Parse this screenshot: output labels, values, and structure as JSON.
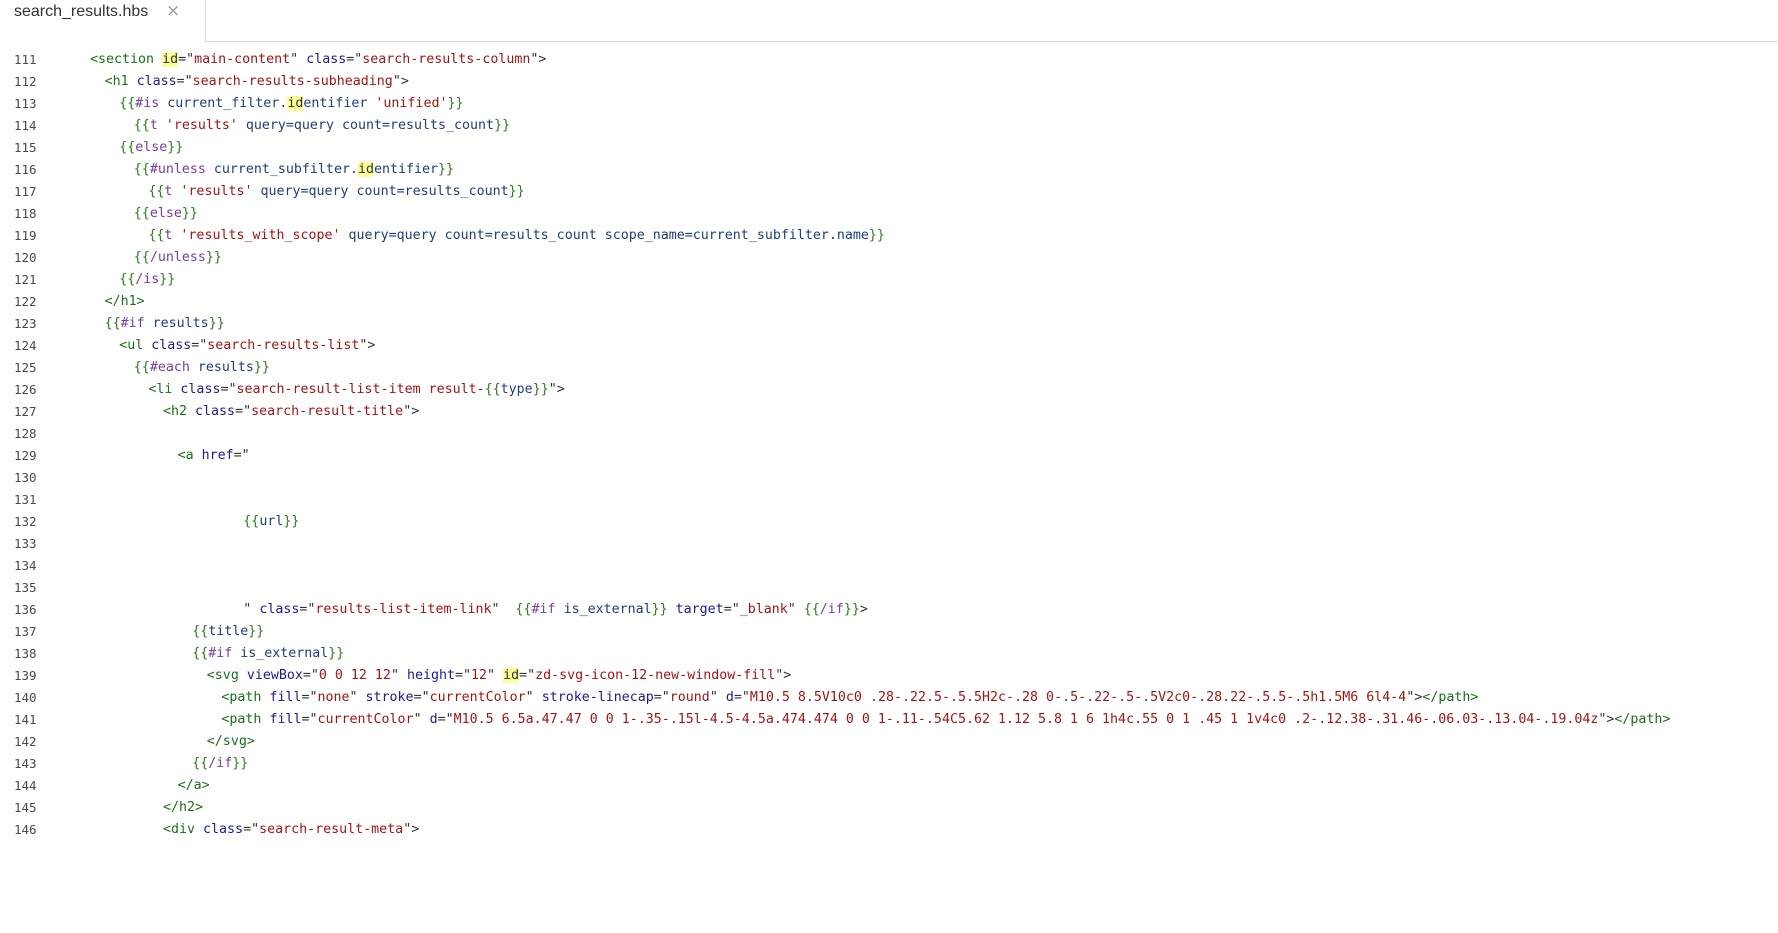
{
  "tab": {
    "filename": "search_results.hbs",
    "close_glyph": "×"
  },
  "colors": {
    "tag": "#1f6e1a",
    "attr": "#1b1b8f",
    "string": "#a31515",
    "keyword": "#7a3e9d",
    "variable": "#1f3f7a",
    "bracket": "#2e7d1f",
    "highlight": "#ffff99"
  },
  "lines": [
    {
      "n": "111",
      "indent": 0,
      "tokens": [
        [
          "tag",
          "<section "
        ],
        [
          "hl",
          "id"
        ],
        [
          "plain",
          "=\""
        ],
        [
          "str",
          "main-content"
        ],
        [
          "plain",
          "\" "
        ],
        [
          "attr",
          "class"
        ],
        [
          "plain",
          "=\""
        ],
        [
          "str",
          "search-results-column"
        ],
        [
          "plain",
          "\">"
        ]
      ]
    },
    {
      "n": "112",
      "indent": 2,
      "tokens": [
        [
          "tag",
          "<h1 "
        ],
        [
          "attr",
          "class"
        ],
        [
          "plain",
          "=\""
        ],
        [
          "str",
          "search-results-subheading"
        ],
        [
          "plain",
          "\">"
        ]
      ]
    },
    {
      "n": "113",
      "indent": 4,
      "tokens": [
        [
          "bracket",
          "{{"
        ],
        [
          "kw",
          "#is "
        ],
        [
          "var",
          "current_filter."
        ],
        [
          "hl",
          "id"
        ],
        [
          "var",
          "entifier "
        ],
        [
          "str",
          "'unified'"
        ],
        [
          "bracket",
          "}}"
        ]
      ]
    },
    {
      "n": "114",
      "indent": 6,
      "tokens": [
        [
          "bracket",
          "{{"
        ],
        [
          "kw",
          "t "
        ],
        [
          "str",
          "'results' "
        ],
        [
          "var",
          "query=query count=results_count"
        ],
        [
          "bracket",
          "}}"
        ]
      ]
    },
    {
      "n": "115",
      "indent": 4,
      "tokens": [
        [
          "bracket",
          "{{"
        ],
        [
          "kw",
          "else"
        ],
        [
          "bracket",
          "}}"
        ]
      ]
    },
    {
      "n": "116",
      "indent": 6,
      "tokens": [
        [
          "bracket",
          "{{"
        ],
        [
          "kw",
          "#unless "
        ],
        [
          "var",
          "current_subfilter."
        ],
        [
          "hl",
          "id"
        ],
        [
          "var",
          "entifier"
        ],
        [
          "bracket",
          "}}"
        ]
      ]
    },
    {
      "n": "117",
      "indent": 8,
      "tokens": [
        [
          "bracket",
          "{{"
        ],
        [
          "kw",
          "t "
        ],
        [
          "str",
          "'results' "
        ],
        [
          "var",
          "query=query count=results_count"
        ],
        [
          "bracket",
          "}}"
        ]
      ]
    },
    {
      "n": "118",
      "indent": 6,
      "tokens": [
        [
          "bracket",
          "{{"
        ],
        [
          "kw",
          "else"
        ],
        [
          "bracket",
          "}}"
        ]
      ]
    },
    {
      "n": "119",
      "indent": 8,
      "tokens": [
        [
          "bracket",
          "{{"
        ],
        [
          "kw",
          "t "
        ],
        [
          "str",
          "'results_with_scope' "
        ],
        [
          "var",
          "query=query count=results_count scope_name=current_subfilter.name"
        ],
        [
          "bracket",
          "}}"
        ]
      ]
    },
    {
      "n": "120",
      "indent": 6,
      "tokens": [
        [
          "bracket",
          "{{"
        ],
        [
          "kw",
          "/unless"
        ],
        [
          "bracket",
          "}}"
        ]
      ]
    },
    {
      "n": "121",
      "indent": 4,
      "tokens": [
        [
          "bracket",
          "{{"
        ],
        [
          "kw",
          "/is"
        ],
        [
          "bracket",
          "}}"
        ]
      ]
    },
    {
      "n": "122",
      "indent": 2,
      "tokens": [
        [
          "tag",
          "</h1>"
        ]
      ]
    },
    {
      "n": "123",
      "indent": 2,
      "tokens": [
        [
          "bracket",
          "{{"
        ],
        [
          "kw",
          "#if "
        ],
        [
          "var",
          "results"
        ],
        [
          "bracket",
          "}}"
        ]
      ]
    },
    {
      "n": "124",
      "indent": 4,
      "tokens": [
        [
          "tag",
          "<ul "
        ],
        [
          "attr",
          "class"
        ],
        [
          "plain",
          "=\""
        ],
        [
          "str",
          "search-results-list"
        ],
        [
          "plain",
          "\">"
        ]
      ]
    },
    {
      "n": "125",
      "indent": 6,
      "tokens": [
        [
          "bracket",
          "{{"
        ],
        [
          "kw",
          "#each "
        ],
        [
          "var",
          "results"
        ],
        [
          "bracket",
          "}}"
        ]
      ]
    },
    {
      "n": "126",
      "indent": 8,
      "tokens": [
        [
          "tag",
          "<li "
        ],
        [
          "attr",
          "class"
        ],
        [
          "plain",
          "=\""
        ],
        [
          "str",
          "search-result-list-item result-"
        ],
        [
          "bracket",
          "{{"
        ],
        [
          "var",
          "type"
        ],
        [
          "bracket",
          "}}"
        ],
        [
          "plain",
          "\">"
        ]
      ]
    },
    {
      "n": "127",
      "indent": 10,
      "tokens": [
        [
          "tag",
          "<h2 "
        ],
        [
          "attr",
          "class"
        ],
        [
          "plain",
          "=\""
        ],
        [
          "str",
          "search-result-title"
        ],
        [
          "plain",
          "\">"
        ]
      ]
    },
    {
      "n": "128",
      "indent": 0,
      "tokens": []
    },
    {
      "n": "129",
      "indent": 12,
      "tokens": [
        [
          "tag",
          "<a "
        ],
        [
          "attr",
          "href"
        ],
        [
          "plain",
          "=\""
        ]
      ]
    },
    {
      "n": "130",
      "indent": 0,
      "tokens": []
    },
    {
      "n": "131",
      "indent": 0,
      "tokens": []
    },
    {
      "n": "132",
      "indent": 21,
      "tokens": [
        [
          "bracket",
          "{{"
        ],
        [
          "var",
          "url"
        ],
        [
          "bracket",
          "}}"
        ]
      ]
    },
    {
      "n": "133",
      "indent": 0,
      "tokens": []
    },
    {
      "n": "134",
      "indent": 0,
      "tokens": []
    },
    {
      "n": "135",
      "indent": 0,
      "tokens": []
    },
    {
      "n": "136",
      "indent": 21,
      "tokens": [
        [
          "plain",
          "\" "
        ],
        [
          "attr",
          "class"
        ],
        [
          "plain",
          "=\""
        ],
        [
          "str",
          "results-list-item-link"
        ],
        [
          "plain",
          "\"  "
        ],
        [
          "bracket",
          "{{"
        ],
        [
          "kw",
          "#if "
        ],
        [
          "var",
          "is_external"
        ],
        [
          "bracket",
          "}}"
        ],
        [
          "plain",
          " "
        ],
        [
          "attr",
          "target"
        ],
        [
          "plain",
          "=\""
        ],
        [
          "str",
          "_blank"
        ],
        [
          "plain",
          "\" "
        ],
        [
          "bracket",
          "{{"
        ],
        [
          "kw",
          "/if"
        ],
        [
          "bracket",
          "}}"
        ],
        [
          "plain",
          ">"
        ]
      ]
    },
    {
      "n": "137",
      "indent": 14,
      "tokens": [
        [
          "bracket",
          "{{"
        ],
        [
          "var",
          "title"
        ],
        [
          "bracket",
          "}}"
        ]
      ]
    },
    {
      "n": "138",
      "indent": 14,
      "tokens": [
        [
          "bracket",
          "{{"
        ],
        [
          "kw",
          "#if "
        ],
        [
          "var",
          "is_external"
        ],
        [
          "bracket",
          "}}"
        ]
      ]
    },
    {
      "n": "139",
      "indent": 16,
      "tokens": [
        [
          "tag",
          "<svg "
        ],
        [
          "attr",
          "viewBox"
        ],
        [
          "plain",
          "=\""
        ],
        [
          "str",
          "0 0 12 12"
        ],
        [
          "plain",
          "\" "
        ],
        [
          "attr",
          "height"
        ],
        [
          "plain",
          "=\""
        ],
        [
          "str",
          "12"
        ],
        [
          "plain",
          "\" "
        ],
        [
          "hl",
          "id"
        ],
        [
          "plain",
          "=\""
        ],
        [
          "str",
          "zd-svg-icon-12-new-window-fill"
        ],
        [
          "plain",
          "\">"
        ]
      ]
    },
    {
      "n": "140",
      "indent": 18,
      "tokens": [
        [
          "tag",
          "<path "
        ],
        [
          "attr",
          "fill"
        ],
        [
          "plain",
          "=\""
        ],
        [
          "str",
          "none"
        ],
        [
          "plain",
          "\" "
        ],
        [
          "attr",
          "stroke"
        ],
        [
          "plain",
          "=\""
        ],
        [
          "str",
          "currentColor"
        ],
        [
          "plain",
          "\" "
        ],
        [
          "attr",
          "stroke-linecap"
        ],
        [
          "plain",
          "=\""
        ],
        [
          "str",
          "round"
        ],
        [
          "plain",
          "\" "
        ],
        [
          "attr",
          "d"
        ],
        [
          "plain",
          "=\""
        ],
        [
          "str",
          "M10.5 8.5V10c0 .28-.22.5-.5.5H2c-.28 0-.5-.22-.5-.5V2c0-.28.22-.5.5-.5h1.5M6 6l4-4"
        ],
        [
          "plain",
          "\">"
        ],
        [
          "tag",
          "</path>"
        ]
      ]
    },
    {
      "n": "141",
      "indent": 18,
      "tokens": [
        [
          "tag",
          "<path "
        ],
        [
          "attr",
          "fill"
        ],
        [
          "plain",
          "=\""
        ],
        [
          "str",
          "currentColor"
        ],
        [
          "plain",
          "\" "
        ],
        [
          "attr",
          "d"
        ],
        [
          "plain",
          "=\""
        ],
        [
          "str",
          "M10.5 6.5a.47.47 0 0 1-.35-.15l-4.5-4.5a.474.474 0 0 1-.11-.54C5.62 1.12 5.8 1 6 1h4c.55 0 1 .45 1 1v4c0 .2-.12.38-.31.46-.06.03-.13.04-.19.04z"
        ],
        [
          "plain",
          "\">"
        ],
        [
          "tag",
          "</path>"
        ]
      ]
    },
    {
      "n": "142",
      "indent": 16,
      "tokens": [
        [
          "tag",
          "</svg>"
        ]
      ]
    },
    {
      "n": "143",
      "indent": 14,
      "tokens": [
        [
          "bracket",
          "{{"
        ],
        [
          "kw",
          "/if"
        ],
        [
          "bracket",
          "}}"
        ]
      ]
    },
    {
      "n": "144",
      "indent": 12,
      "tokens": [
        [
          "tag",
          "</a>"
        ]
      ]
    },
    {
      "n": "145",
      "indent": 10,
      "tokens": [
        [
          "tag",
          "</h2>"
        ]
      ]
    },
    {
      "n": "146",
      "indent": 10,
      "tokens": [
        [
          "tag",
          "<div "
        ],
        [
          "attr",
          "class"
        ],
        [
          "plain",
          "=\""
        ],
        [
          "str",
          "search-result-meta"
        ],
        [
          "plain",
          "\">"
        ]
      ]
    }
  ]
}
